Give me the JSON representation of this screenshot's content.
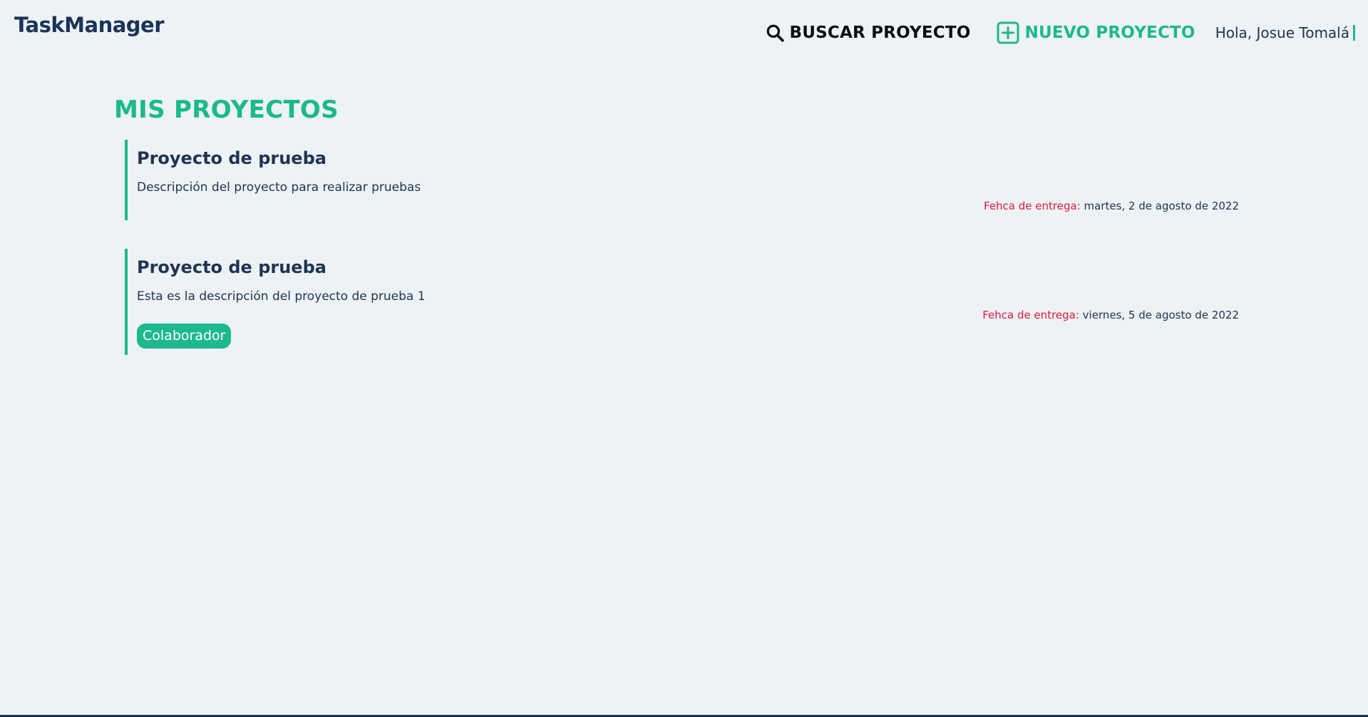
{
  "app": {
    "brand": "TaskManager"
  },
  "nav": {
    "search_label": "BUSCAR PROYECTO",
    "search_icon": "search-icon",
    "new_label": "NUEVO PROYECTO",
    "new_icon": "plus-square-icon",
    "greeting": "Hola, Josue Tomalá"
  },
  "main": {
    "title": "MIS PROYECTOS",
    "projects": [
      {
        "name": "Proyecto de prueba",
        "description": "Descripción del proyecto para realizar pruebas",
        "date_label": "Fehca de entrega:",
        "date_value": " martes, 2 de agosto de 2022",
        "badge": ""
      },
      {
        "name": "Proyecto de prueba",
        "description": "Esta es la descripción del proyecto de prueba 1",
        "date_label": "Fehca de entrega:",
        "date_value": " viernes, 5 de agosto de 2022",
        "badge": "Colaborador"
      }
    ]
  },
  "colors": {
    "accent": "#1cb88e",
    "navy": "#1b3358",
    "date_label": "#e0193d",
    "background": "#edf2f4"
  }
}
